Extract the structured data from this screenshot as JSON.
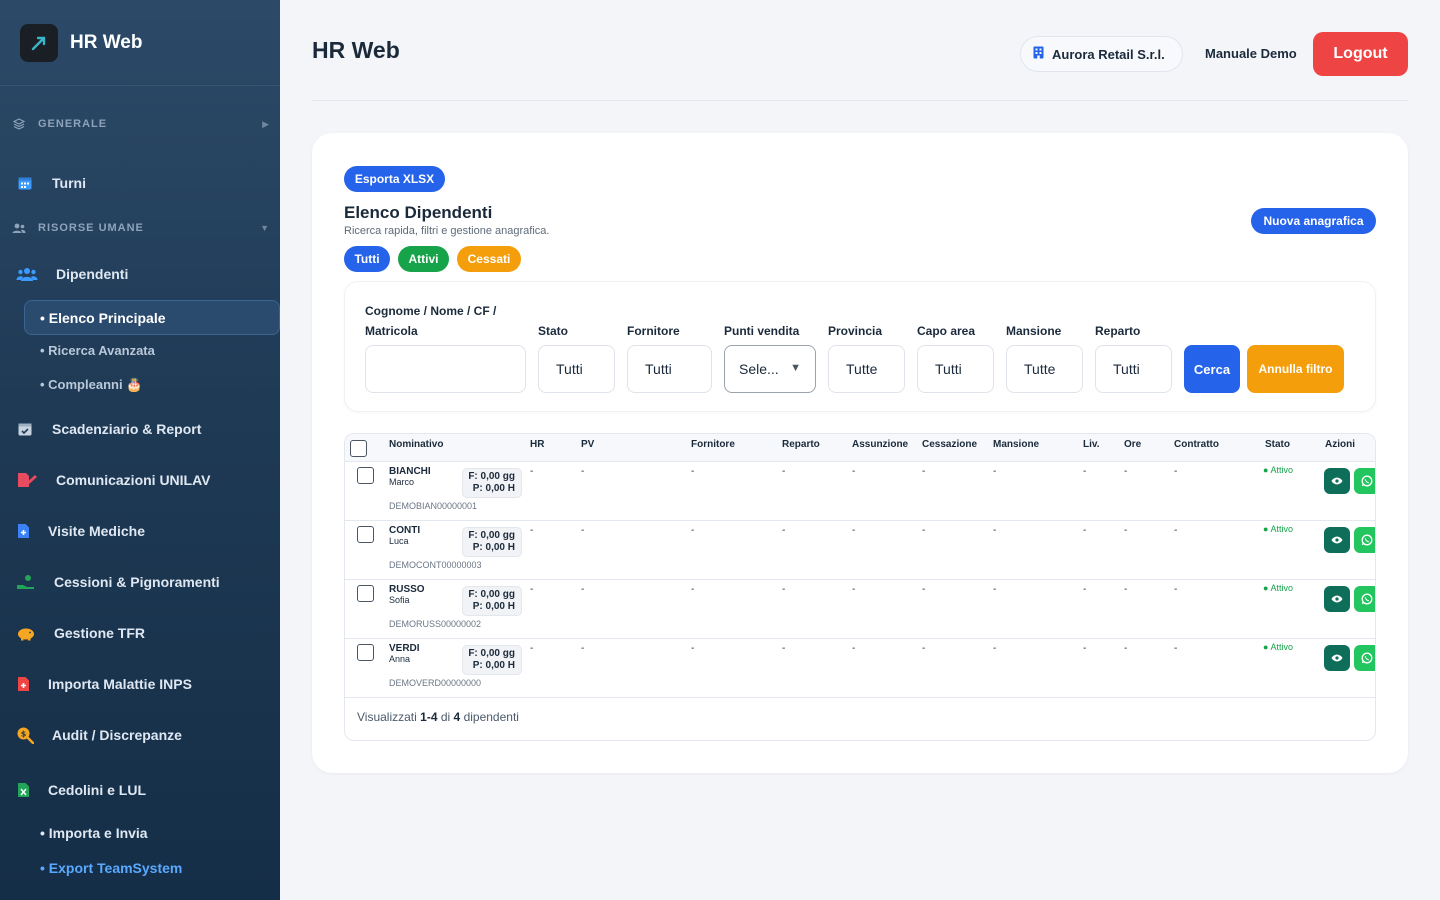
{
  "app": {
    "brand": "HR Web",
    "page_title": "HR Web"
  },
  "header": {
    "company": "Aurora Retail S.r.l.",
    "manual": "Manuale Demo",
    "logout": "Logout"
  },
  "sidebar": {
    "sections": [
      {
        "label": "GENERALE",
        "icon": "layers-icon"
      },
      {
        "label": "RISORSE UMANE",
        "icon": "users-icon"
      }
    ],
    "items": [
      {
        "label": "Turni",
        "icon": "calendar-icon"
      },
      {
        "label": "Dipendenti",
        "icon": "users-icon"
      },
      {
        "label": "Scadenziario & Report",
        "icon": "calendar-check-icon"
      },
      {
        "label": "Comunicazioni UNILAV",
        "icon": "file-signature-icon"
      },
      {
        "label": "Visite Mediche",
        "icon": "file-medical-icon"
      },
      {
        "label": "Cessioni & Pignoramenti",
        "icon": "hand-money-icon"
      },
      {
        "label": "Gestione TFR",
        "icon": "piggy-bank-icon"
      },
      {
        "label": "Importa Malattie INPS",
        "icon": "file-plus-icon"
      },
      {
        "label": "Audit / Discrepanze",
        "icon": "search-dollar-icon"
      },
      {
        "label": "Cedolini e LUL",
        "icon": "file-excel-icon"
      }
    ],
    "sub_dipendenti": [
      "• Elenco Principale",
      "• Ricerca Avanzata",
      "• Compleanni 🎂"
    ],
    "sub_cedolini": [
      "• Importa e Invia",
      "• Export TeamSystem"
    ]
  },
  "card": {
    "export_btn": "Esporta XLSX",
    "title": "Elenco Dipendenti",
    "subtitle": "Ricerca rapida, filtri e gestione anagrafica.",
    "new_btn": "Nuova anagrafica",
    "filter_pills": [
      "Tutti",
      "Attivi",
      "Cessati"
    ]
  },
  "filters": {
    "search_label_1": "Cognome / Nome / CF /",
    "search_label_2": "Matricola",
    "search_value": "",
    "stato": {
      "label": "Stato",
      "value": "Tutti"
    },
    "fornitore": {
      "label": "Fornitore",
      "value": "Tutti"
    },
    "punti_vendita": {
      "label": "Punti vendita",
      "value": "Sele..."
    },
    "provincia": {
      "label": "Provincia",
      "value": "Tutte"
    },
    "capo_area": {
      "label": "Capo area",
      "value": "Tutti"
    },
    "mansione": {
      "label": "Mansione",
      "value": "Tutte"
    },
    "reparto": {
      "label": "Reparto",
      "value": "Tutti"
    },
    "cerca": "Cerca",
    "annulla": "Annulla filtro"
  },
  "table": {
    "columns": [
      "Nominativo",
      "HR",
      "PV",
      "Fornitore",
      "Reparto",
      "Assunzione",
      "Cessazione",
      "Mansione",
      "Liv.",
      "Ore",
      "Contratto",
      "Stato",
      "Azioni"
    ],
    "rows": [
      {
        "surname": "BIANCHI",
        "name": "Marco",
        "code": "DEMOBIAN00000001",
        "f": "F: 0,00 gg",
        "p": "P: 0,00 H",
        "empty": "-",
        "status": "● Attivo"
      },
      {
        "surname": "CONTI",
        "name": "Luca",
        "code": "DEMOCONT00000003",
        "f": "F: 0,00 gg",
        "p": "P: 0,00 H",
        "empty": "-",
        "status": "● Attivo"
      },
      {
        "surname": "RUSSO",
        "name": "Sofia",
        "code": "DEMORUSS00000002",
        "f": "F: 0,00 gg",
        "p": "P: 0,00 H",
        "empty": "-",
        "status": "● Attivo"
      },
      {
        "surname": "VERDI",
        "name": "Anna",
        "code": "DEMOVERD00000000",
        "f": "F: 0,00 gg",
        "p": "P: 0,00 H",
        "empty": "-",
        "status": "● Attivo"
      }
    ],
    "footer": {
      "prefix": "Visualizzati",
      "range": "1-4",
      "of": "di",
      "total": "4",
      "suffix": "dipendenti"
    }
  },
  "colors": {
    "primary": "#2563eb",
    "success": "#16a34a",
    "warning": "#f59e0b",
    "danger": "#ef4444",
    "sidebar": "#1f3a55"
  }
}
